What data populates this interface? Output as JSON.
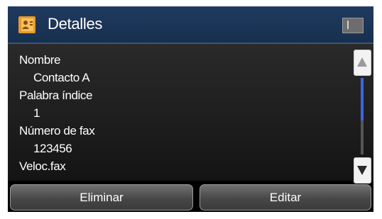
{
  "header": {
    "title": "Detalles",
    "icon": "contact-book-icon",
    "status_icon": "status-indicator-icon"
  },
  "details": [
    {
      "label": "Nombre",
      "value": "Contacto A"
    },
    {
      "label": "Palabra índice",
      "value": "1"
    },
    {
      "label": "Número de fax",
      "value": "123456"
    },
    {
      "label": "Veloc.fax",
      "value": ""
    }
  ],
  "scroll": {
    "up_icon": "scroll-up-arrow-icon",
    "down_icon": "scroll-down-arrow-icon"
  },
  "buttons": {
    "delete_label": "Eliminar",
    "edit_label": "Editar"
  },
  "colors": {
    "titlebar": "#1c3557",
    "scroll_thumb": "#3a66e6",
    "button_gray": "#5a5a5a"
  }
}
